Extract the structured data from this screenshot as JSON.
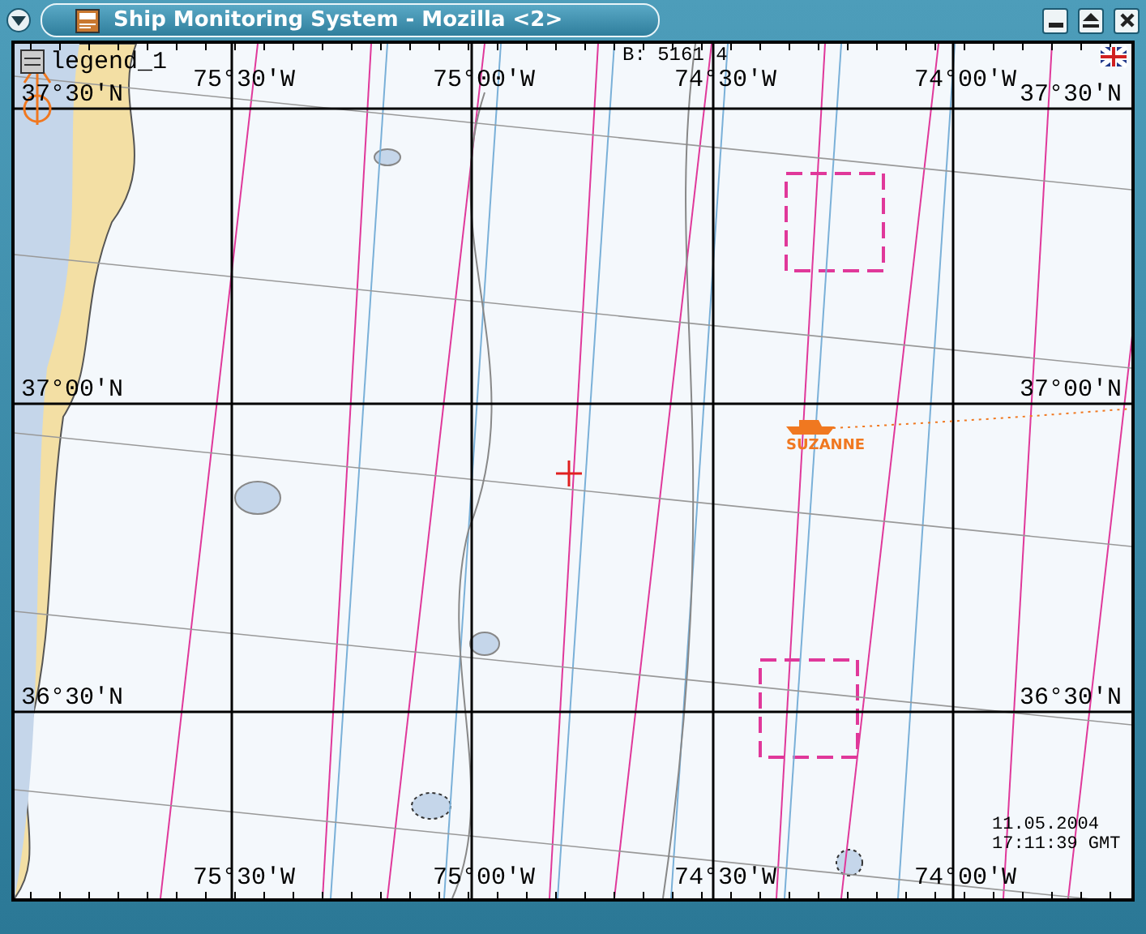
{
  "window": {
    "title": "Ship Monitoring System - Mozilla <2>"
  },
  "map": {
    "layer_label": "legend_1",
    "bearing_readout": "B: 5161 4",
    "latitude_lines": [
      {
        "left_label": "37°30'N",
        "right_label": "37°30'N"
      },
      {
        "left_label": "37°00'N",
        "right_label": "37°00'N"
      },
      {
        "left_label": "36°30'N",
        "right_label": "36°30'N"
      }
    ],
    "longitude_lines": [
      {
        "top_label": "75°30'W",
        "bottom_label": "75°30'W"
      },
      {
        "top_label": "75°00'W",
        "bottom_label": "75°00'W"
      },
      {
        "top_label": "74°30'W",
        "bottom_label": "74°30'W"
      },
      {
        "top_label": "74°00'W",
        "bottom_label": "74°00'W"
      }
    ],
    "ships": [
      {
        "name": "SUZANNE"
      }
    ],
    "timestamp": {
      "date": "11.05.2004",
      "time": "17:11:39 GMT"
    }
  }
}
